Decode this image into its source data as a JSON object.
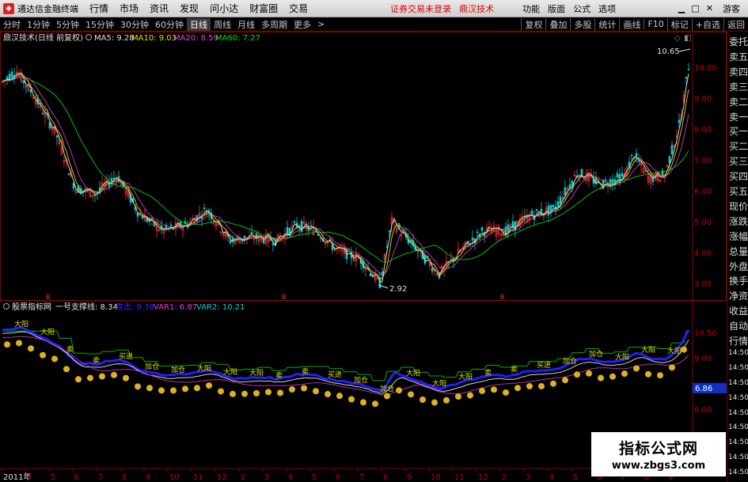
{
  "menubar": {
    "title": "通达信金融终端",
    "items": [
      "行情",
      "市场",
      "资讯",
      "发现",
      "问小达",
      "财富圈",
      "交易"
    ],
    "login_status": "证券交易未登录",
    "brand": "鼎汉技术",
    "right_items": [
      "功能",
      "版面",
      "公式",
      "选项"
    ],
    "guest": "游客"
  },
  "tabbar": {
    "periods": [
      "分时",
      "1分钟",
      "5分钟",
      "15分钟",
      "30分钟",
      "60分钟",
      "日线",
      "周线",
      "月线",
      "多周期",
      "更多"
    ],
    "active": "日线",
    "buttons": [
      "复权",
      "叠加",
      "多股",
      "统计",
      "画线",
      "F10",
      "标记",
      "+自选",
      "返回"
    ]
  },
  "main_chart": {
    "title": "鼎汉技术(日线 前复权)",
    "ma_labels": [
      "MA5: 9.28",
      "MA10: 9.03",
      "MA20: 8.59",
      "MA60: 7.27"
    ],
    "ma_colors": [
      "#e0e0e0",
      "#e0e000",
      "#e040e0",
      "#00e000"
    ],
    "price_axis": [
      "10.00",
      "9.00",
      "8.00",
      "7.00",
      "6.00",
      "5.00",
      "4.00",
      "3.00"
    ],
    "high_label": "10.65",
    "low_label": "2.92",
    "markers": [
      "B",
      "B",
      "B"
    ]
  },
  "sub_chart": {
    "title": "股票指标网",
    "labels": [
      "一号支撑线: 8.34",
      "攻击: 9.38",
      "VAR1: 6.87",
      "VAR2: 10.21"
    ],
    "label_colors": [
      "#e0e0e0",
      "#3030ff",
      "#e040e0",
      "#00d0d0"
    ],
    "axis": [
      "10.50",
      "9.00",
      "6.00"
    ],
    "current_value": "6.86",
    "words": [
      "大阳",
      "买进",
      "大阳",
      "卖",
      "加仓",
      "大阳",
      "卖",
      "加仓"
    ]
  },
  "x_axis": [
    "2011年",
    "4",
    "5",
    "6",
    "7",
    "8",
    "9",
    "10",
    "11",
    "12",
    "2",
    "3",
    "4",
    "5",
    "6",
    "7",
    "8",
    "9",
    "10",
    "11",
    "12",
    "2",
    "3",
    "4",
    "5",
    "6",
    "7",
    "8",
    "9",
    "10"
  ],
  "sidepanel": {
    "items": [
      "委托",
      "卖五",
      "卖四",
      "卖三",
      "卖二",
      "卖一",
      "买一",
      "买二",
      "买三",
      "买四",
      "买五",
      "现价",
      "涨跌",
      "涨幅",
      "总量",
      "外盘",
      "换手",
      "净资",
      "收益",
      "自动",
      "行情",
      "14:50",
      "14:50",
      "14:50",
      "14:50",
      "14:50",
      "14:50",
      "14:50",
      "14:50",
      "14:50"
    ]
  },
  "watermark": {
    "title": "指标公式网",
    "url": "www.zbgs3.com"
  }
}
